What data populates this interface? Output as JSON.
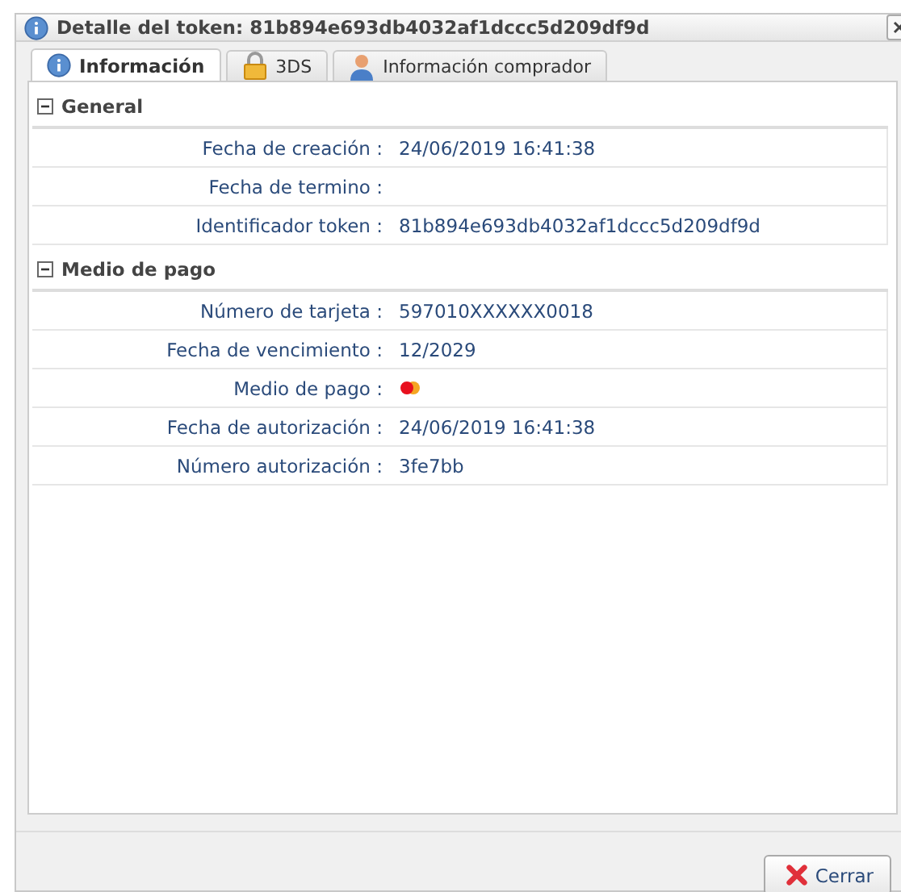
{
  "window": {
    "title": "Detalle del token: 81b894e693db4032af1dccc5d209df9d"
  },
  "tabs": [
    {
      "label": "Información",
      "kind": "info",
      "selected": true
    },
    {
      "label": "3DS",
      "kind": "lock",
      "selected": false
    },
    {
      "label": "Información comprador",
      "kind": "user",
      "selected": false
    }
  ],
  "sections": [
    {
      "title": "General",
      "expanded": true,
      "rows": [
        {
          "label": "Fecha de creación :",
          "kind": "text",
          "value": "24/06/2019 16:41:38"
        },
        {
          "label": "Fecha de termino :",
          "kind": "text"
        },
        {
          "label": "Identificador token :",
          "kind": "text",
          "value": "81b894e693db4032af1dccc5d209df9d"
        }
      ]
    },
    {
      "title": "Medio de pago",
      "expanded": true,
      "rows": [
        {
          "label": "Número de tarjeta :",
          "kind": "text",
          "value": "597010XXXXXX0018"
        },
        {
          "label": "Fecha de vencimiento :",
          "kind": "text",
          "value": "12/2029"
        },
        {
          "label": "Medio de pago :",
          "kind": "card-logo"
        },
        {
          "label": "Fecha de autorización :",
          "kind": "text",
          "value": "24/06/2019 16:41:38"
        },
        {
          "label": "Número autorización :",
          "kind": "text",
          "value": "3fe7bb"
        }
      ]
    }
  ],
  "buttons": [
    {
      "label": "Cerrar",
      "kind": "close"
    }
  ]
}
